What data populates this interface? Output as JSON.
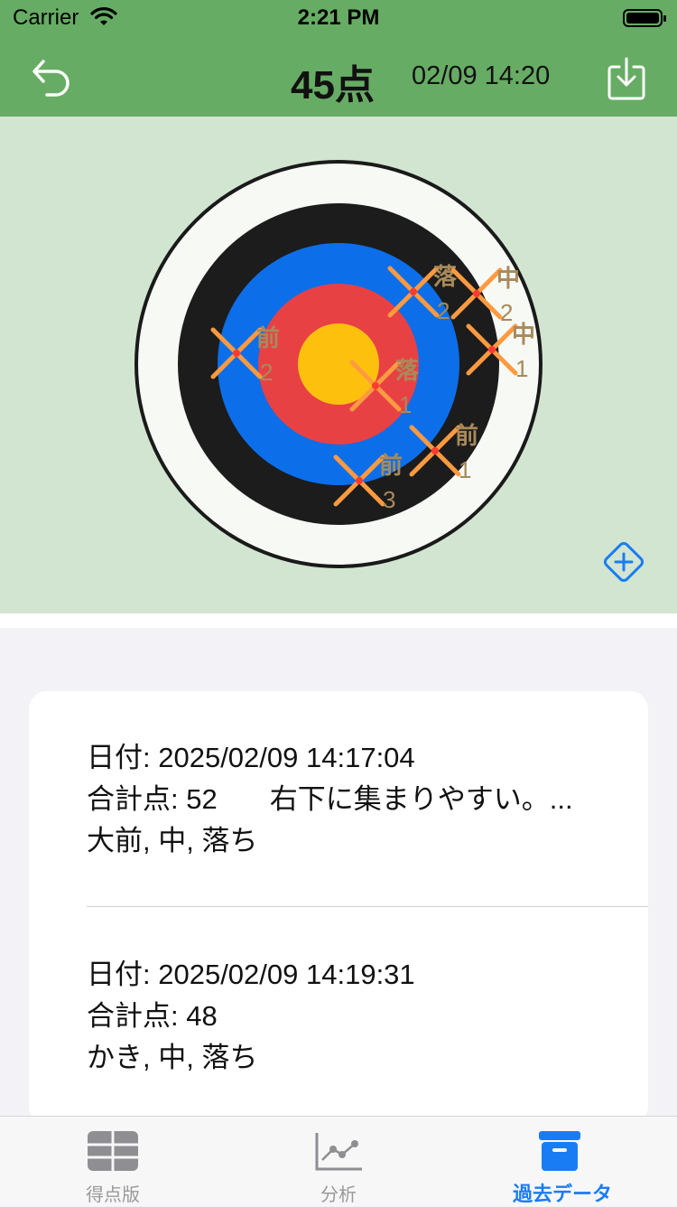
{
  "status_bar": {
    "carrier": "Carrier",
    "time": "2:21 PM"
  },
  "header": {
    "score": "45点",
    "date": "02/09 14:20"
  },
  "target": {
    "colors": {
      "background": "#d2e5d1",
      "ring_white": "#f7f9f5",
      "ring_black": "#1c1c1c",
      "ring_blue": "#0c6ee9",
      "ring_red": "#e84144",
      "center_gold": "#fdc10d",
      "arrow_mark": "#ff9a40",
      "arrow_label": "#a88a5a"
    },
    "arrows": [
      {
        "label": "落",
        "number": "2"
      },
      {
        "label": "中",
        "number": "2"
      },
      {
        "label": "中",
        "number": "1"
      },
      {
        "label": "前",
        "number": "2"
      },
      {
        "label": "落",
        "number": "1"
      },
      {
        "label": "前",
        "number": "1"
      },
      {
        "label": "前",
        "number": "3"
      }
    ]
  },
  "history": [
    {
      "date": "日付: 2025/02/09 14:17:04",
      "total": "合計点: 52",
      "memo": "右下に集まりやすい。...",
      "tags": "大前, 中, 落ち"
    },
    {
      "date": "日付: 2025/02/09 14:19:31",
      "total": "合計点: 48",
      "memo": "",
      "tags": "かき, 中, 落ち"
    }
  ],
  "tabs": [
    {
      "label": "得点版",
      "icon": "score-table-icon",
      "active": false
    },
    {
      "label": "分析",
      "icon": "line-chart-icon",
      "active": false
    },
    {
      "label": "過去データ",
      "icon": "archive-box-icon",
      "active": true
    }
  ]
}
